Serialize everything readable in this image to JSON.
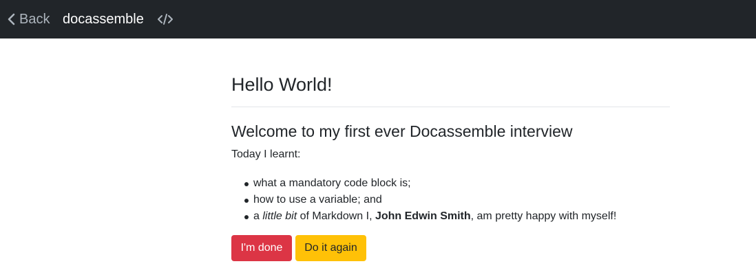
{
  "nav": {
    "back_label": "Back",
    "brand": "docassemble",
    "icons": {
      "back": "chevron-left-icon",
      "source": "code-icon"
    },
    "background": "#212529"
  },
  "question": {
    "title": "Hello World!",
    "subheading": "Welcome to my first ever Docassemble interview",
    "intro": "Today I learnt:",
    "items": [
      {
        "text": "what a mandatory code block is;"
      },
      {
        "text": "how to use a variable; and"
      },
      {
        "prefix": "a ",
        "italic": "little bit",
        "middle": " of Markdown I, ",
        "bold": "John Edwin Smith",
        "suffix": ", am pretty happy with myself!"
      }
    ]
  },
  "buttons": {
    "done": {
      "label": "I'm done",
      "color": "#dc3545"
    },
    "again": {
      "label": "Do it again",
      "color": "#ffc107"
    }
  }
}
